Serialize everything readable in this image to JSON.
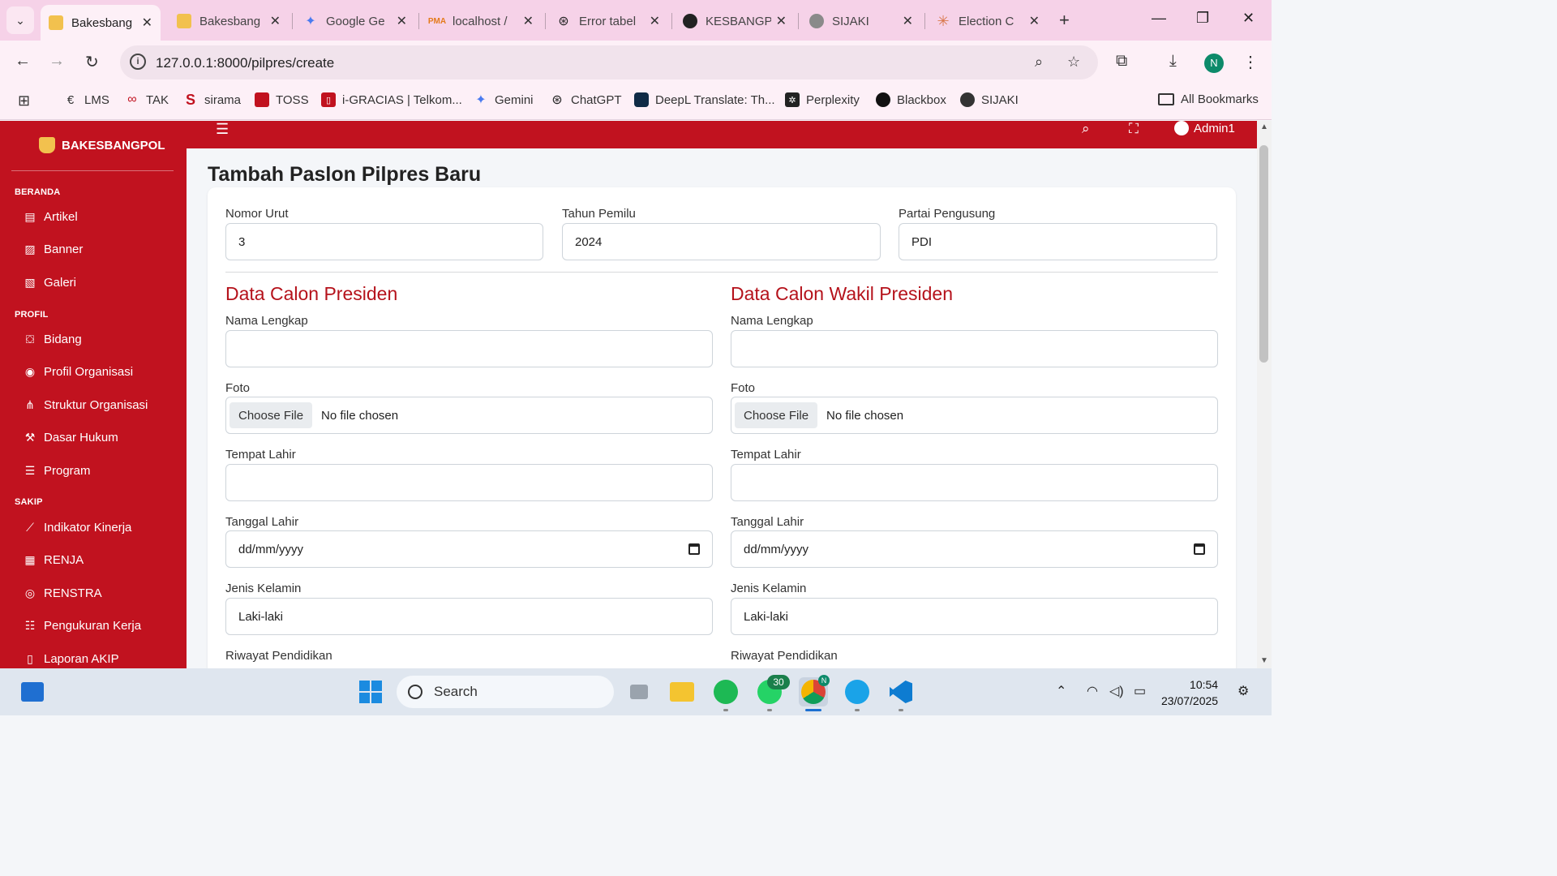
{
  "browser": {
    "tabs": [
      {
        "title": "Bakesbang",
        "active": true
      },
      {
        "title": "Bakesbang",
        "active": false
      },
      {
        "title": "Google Ge",
        "active": false
      },
      {
        "title": "localhost /",
        "active": false
      },
      {
        "title": "Error tabel",
        "active": false
      },
      {
        "title": "KESBANGP",
        "active": false
      },
      {
        "title": "SIJAKI",
        "active": false
      },
      {
        "title": "Election C",
        "active": false
      }
    ],
    "url": "127.0.0.1:8000/pilpres/create",
    "profile_initial": "N",
    "bookmarks": [
      "LMS",
      "TAK",
      "sirama",
      "TOSS",
      "i-GRACIAS | Telkom...",
      "Gemini",
      "ChatGPT",
      "DeepL Translate: Th...",
      "Perplexity",
      "Blackbox",
      "SIJAKI"
    ],
    "all_bookmarks_label": "All Bookmarks"
  },
  "sidebar": {
    "brand": "BAKESBANGPOL",
    "sections": [
      {
        "title": "BERANDA",
        "items": [
          {
            "label": "Artikel",
            "icon": "newspaper-icon"
          },
          {
            "label": "Banner",
            "icon": "image-icon"
          },
          {
            "label": "Galeri",
            "icon": "images-icon"
          }
        ]
      },
      {
        "title": "PROFIL",
        "items": [
          {
            "label": "Bidang",
            "icon": "sitemap-icon"
          },
          {
            "label": "Profil Organisasi",
            "icon": "eye-icon"
          },
          {
            "label": "Struktur Organisasi",
            "icon": "hierarchy-icon"
          },
          {
            "label": "Dasar Hukum",
            "icon": "gavel-icon"
          },
          {
            "label": "Program",
            "icon": "list-icon"
          }
        ]
      },
      {
        "title": "SAKIP",
        "items": [
          {
            "label": "Indikator Kinerja",
            "icon": "chart-line-icon"
          },
          {
            "label": "RENJA",
            "icon": "calendar-icon"
          },
          {
            "label": "RENSTRA",
            "icon": "target-icon"
          },
          {
            "label": "Pengukuran Kerja",
            "icon": "tasks-icon"
          },
          {
            "label": "Laporan AKIP",
            "icon": "file-icon"
          }
        ]
      }
    ]
  },
  "topbar": {
    "user": "Admin1"
  },
  "page": {
    "title": "Tambah Paslon Pilpres Baru",
    "fields": {
      "nomor_urut": {
        "label": "Nomor Urut",
        "value": "3"
      },
      "tahun_pemilu": {
        "label": "Tahun Pemilu",
        "value": "2024"
      },
      "partai": {
        "label": "Partai Pengusung",
        "value": "PDI"
      }
    },
    "capres": {
      "title": "Data Calon Presiden",
      "nama_label": "Nama Lengkap",
      "nama_value": "",
      "foto_label": "Foto",
      "file_button": "Choose File",
      "file_status": "No file chosen",
      "tempat_label": "Tempat Lahir",
      "tempat_value": "",
      "tanggal_label": "Tanggal Lahir",
      "tanggal_placeholder": "dd/mm/yyyy",
      "jk_label": "Jenis Kelamin",
      "jk_value": "Laki-laki",
      "pendidikan_label": "Riwayat Pendidikan"
    },
    "cawapres": {
      "title": "Data Calon Wakil Presiden",
      "nama_label": "Nama Lengkap",
      "nama_value": "",
      "foto_label": "Foto",
      "file_button": "Choose File",
      "file_status": "No file chosen",
      "tempat_label": "Tempat Lahir",
      "tempat_value": "",
      "tanggal_label": "Tanggal Lahir",
      "tanggal_placeholder": "dd/mm/yyyy",
      "jk_label": "Jenis Kelamin",
      "jk_value": "Laki-laki",
      "pendidikan_label": "Riwayat Pendidikan"
    }
  },
  "taskbar": {
    "search_label": "Search",
    "whatsapp_badge": "30",
    "chrome_profile": "N",
    "time": "10:54",
    "date": "23/07/2025"
  },
  "colors": {
    "brand_red": "#c1121f",
    "section_title_red": "#b5121b",
    "tab_bar_pink": "#f6d2e8"
  }
}
